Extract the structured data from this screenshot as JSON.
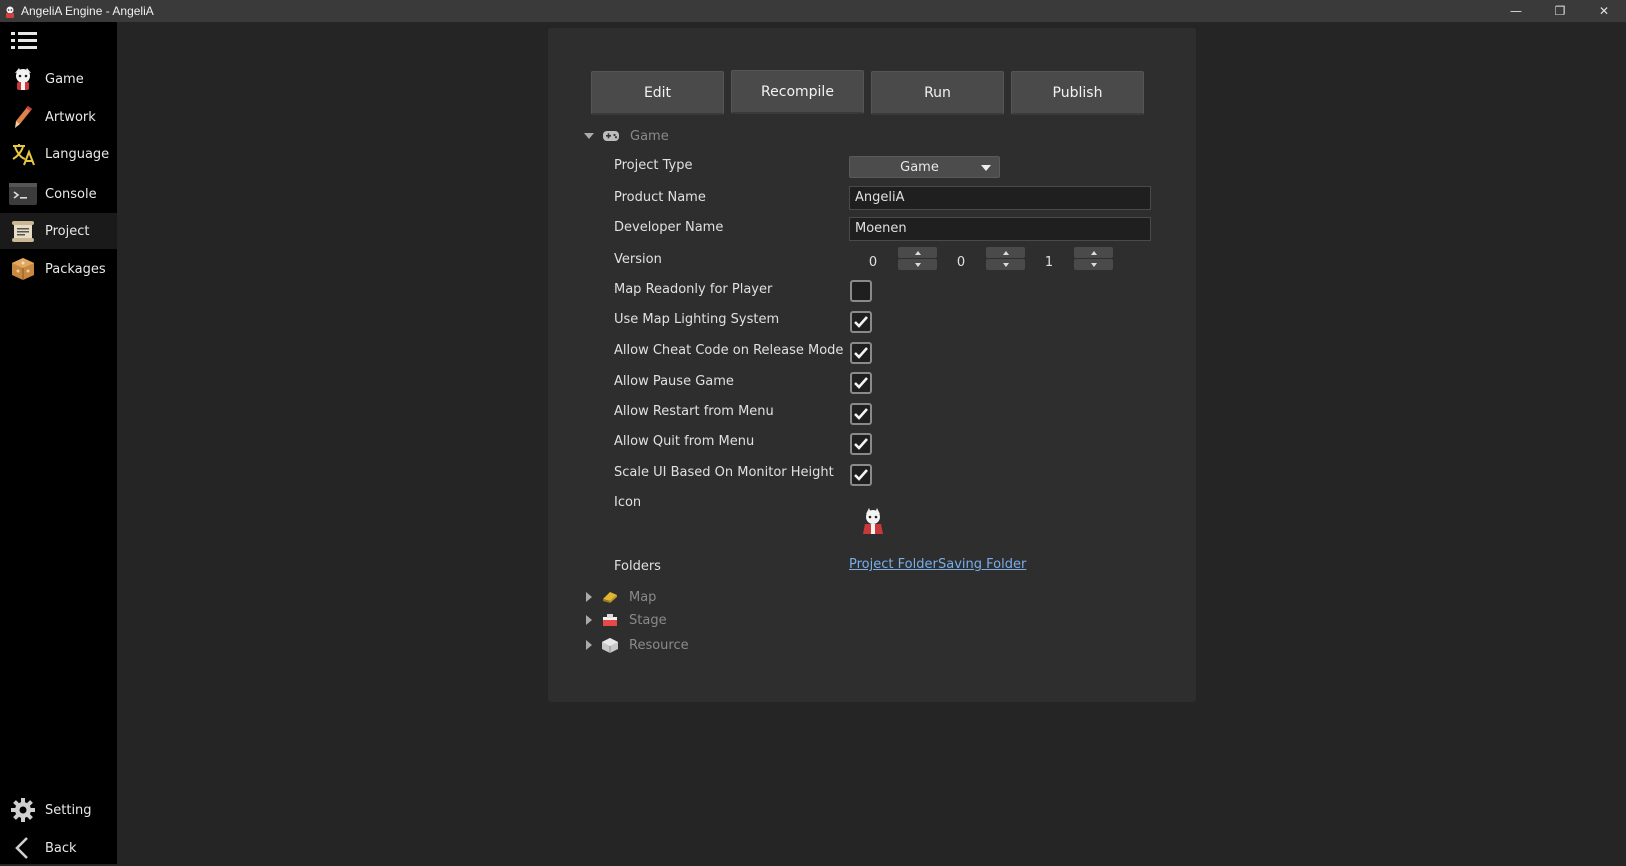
{
  "window": {
    "title": "AngeliA Engine - AngeliA",
    "controls": {
      "minimize": "—",
      "restore": "❐",
      "close": "✕"
    }
  },
  "sidebar": {
    "items": [
      {
        "label": "Game",
        "icon": "game-icon"
      },
      {
        "label": "Artwork",
        "icon": "artwork-icon"
      },
      {
        "label": "Language",
        "icon": "language-icon"
      },
      {
        "label": "Console",
        "icon": "console-icon"
      },
      {
        "label": "Project",
        "icon": "project-icon",
        "active": true
      },
      {
        "label": "Packages",
        "icon": "packages-icon"
      }
    ],
    "bottom": [
      {
        "label": "Setting",
        "icon": "gear-icon"
      },
      {
        "label": "Back",
        "icon": "back-icon"
      }
    ]
  },
  "toolbar": {
    "edit": "Edit",
    "recompile": "Recompile",
    "run": "Run",
    "publish": "Publish"
  },
  "sections": {
    "game": "Game",
    "map": "Map",
    "stage": "Stage",
    "resource": "Resource"
  },
  "props": {
    "project_type_label": "Project Type",
    "project_type_value": "Game",
    "product_name_label": "Product Name",
    "product_name_value": "AngeliA",
    "developer_name_label": "Developer Name",
    "developer_name_value": "Moenen",
    "version_label": "Version",
    "version": {
      "major": "0",
      "minor": "0",
      "patch": "1"
    },
    "map_readonly_label": "Map Readonly for Player",
    "map_readonly": false,
    "lighting_label": "Use Map Lighting System",
    "lighting": true,
    "cheat_label": "Allow Cheat Code on Release Mode",
    "cheat": true,
    "pause_label": "Allow Pause Game",
    "pause": true,
    "restart_label": "Allow Restart from Menu",
    "restart": true,
    "quit_label": "Allow Quit from Menu",
    "quit": true,
    "scale_ui_label": "Scale UI Based On Monitor Height",
    "scale_ui": true,
    "icon_label": "Icon",
    "folders_label": "Folders",
    "project_folder": "Project Folder",
    "saving_folder": "Saving Folder"
  },
  "colors": {
    "accent_link": "#7aaee8",
    "panel_bg": "#2e2e2e",
    "sidebar_bg": "#000000"
  }
}
